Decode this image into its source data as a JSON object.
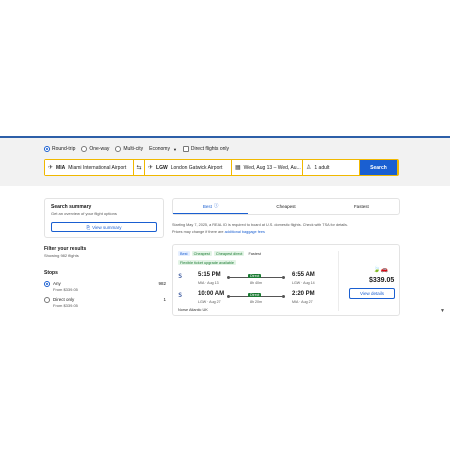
{
  "trip_types": [
    {
      "label": "Round-trip",
      "selected": true
    },
    {
      "label": "One-way",
      "selected": false
    },
    {
      "label": "Multi-city",
      "selected": false
    }
  ],
  "cabin": "Economy",
  "direct_only_label": "Direct flights only",
  "search": {
    "origin_code": "MIA",
    "origin_name": "Miami International Airport",
    "dest_code": "LGW",
    "dest_name": "London Gatwick Airport",
    "dates": "Wed, Aug 13 – Wed, Au...",
    "travellers": "1 adult",
    "button": "Search"
  },
  "summary": {
    "title": "Search summary",
    "subtitle": "Get an overview of your flight options",
    "button": "View summary"
  },
  "filters": {
    "title": "Filter your results",
    "showing": "Showing 982 flights",
    "stops_title": "Stops",
    "stops": [
      {
        "label": "Any",
        "price": "From $339.05",
        "count": "982",
        "selected": true
      },
      {
        "label": "Direct only",
        "price": "From $339.05",
        "count": "1",
        "selected": false
      }
    ]
  },
  "tabs": [
    {
      "label": "Best",
      "active": true
    },
    {
      "label": "Cheapest",
      "active": false
    },
    {
      "label": "Fastest",
      "active": false
    }
  ],
  "notice": {
    "text": "Starting May 7, 2025, a REAL ID is required to board at U.S. domestic flights. Check with TSA for details.",
    "fees_text": "Prices may change if there are",
    "fees_link": "additional baggage fees"
  },
  "result": {
    "badges": [
      "Best",
      "Cheapest",
      "Cheapest direct",
      "Fastest"
    ],
    "flexible": "Flexible ticket upgrade available",
    "legs": [
      {
        "dep_time": "5:15 PM",
        "dep_apt": "MIA · Aug 13",
        "stops": "Direct",
        "duration": "8h 40m",
        "arr_time": "6:55 AM",
        "arr_apt": "LGW · Aug 14"
      },
      {
        "dep_time": "10:00 AM",
        "dep_apt": "LGW · Aug 27",
        "stops": "Direct",
        "duration": "8h 20m",
        "arr_time": "2:20 PM",
        "arr_apt": "MIA · Aug 27"
      }
    ],
    "carrier": "Norse Atlantic UK",
    "price": "$339.05",
    "details_button": "View details"
  }
}
